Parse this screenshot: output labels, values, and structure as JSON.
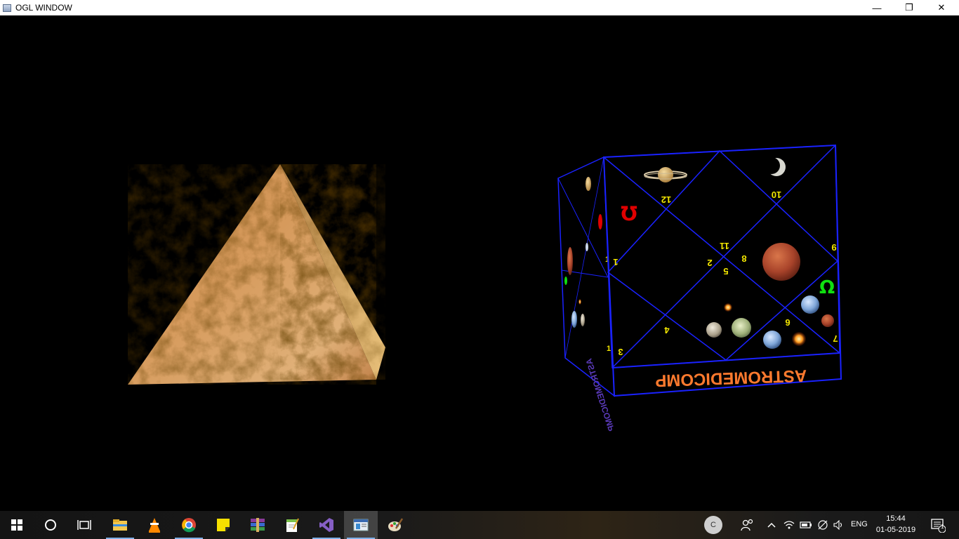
{
  "window": {
    "title": "OGL WINDOW",
    "controls": {
      "minimize": "—",
      "restore": "❐",
      "close": "✕"
    }
  },
  "scene": {
    "cube_front": {
      "house_numbers": [
        "12",
        "10",
        "1",
        "11",
        "2",
        "8",
        "9",
        "5",
        "6",
        "4",
        "3",
        "7"
      ],
      "symbols": {
        "ketu": "Ω",
        "rahu": "Ω"
      },
      "label": "ASTROMEDICOMP"
    },
    "cube_side": {
      "label": "ASTROMEDICOMP",
      "house_numbers": [
        "1",
        "1"
      ]
    },
    "colors": {
      "wire": "#1a22ff",
      "number": "#f2e600",
      "label": "#ff7a2e",
      "rahu": "#e00000",
      "ketu": "#10e010"
    }
  },
  "taskbar": {
    "items": [
      {
        "name": "start-button-icon"
      },
      {
        "name": "search-icon"
      },
      {
        "name": "task-view-icon"
      },
      {
        "name": "file-explorer-icon"
      },
      {
        "name": "vlc-icon"
      },
      {
        "name": "chrome-icon"
      },
      {
        "name": "sticky-notes-icon"
      },
      {
        "name": "winrar-icon"
      },
      {
        "name": "notepad-plus-icon"
      },
      {
        "name": "visual-studio-icon"
      },
      {
        "name": "ogl-window-icon"
      },
      {
        "name": "paint-icon"
      }
    ],
    "user_initial": "C",
    "language": "ENG",
    "time": "15:44",
    "date": "01-05-2019",
    "notification_count": "1"
  }
}
